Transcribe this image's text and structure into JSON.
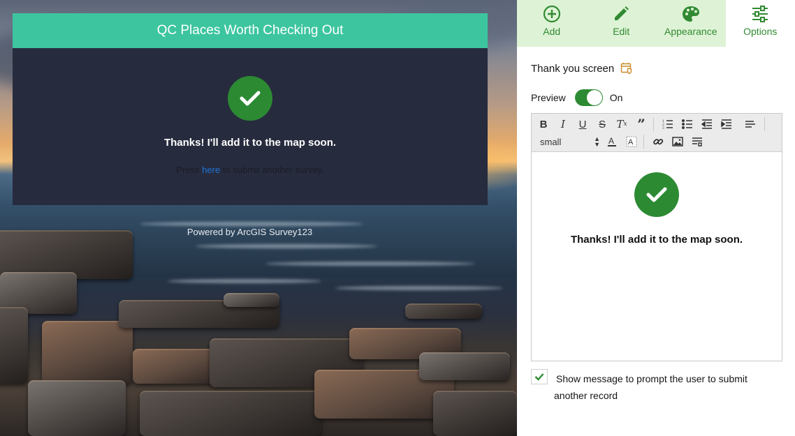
{
  "survey": {
    "title": "QC Places Worth Checking Out",
    "thanks_message": "Thanks! I'll add it to the map soon.",
    "press_prefix": "Press",
    "press_link": "here",
    "press_suffix": "to submit another survey.",
    "powered_by": "Powered by ArcGIS Survey123"
  },
  "toolbar": {
    "items": [
      {
        "label": "Add",
        "icon": "plus-circle-icon"
      },
      {
        "label": "Edit",
        "icon": "pencil-icon"
      },
      {
        "label": "Appearance",
        "icon": "palette-icon"
      },
      {
        "label": "Options",
        "icon": "sliders-icon",
        "active": true
      }
    ]
  },
  "panel": {
    "section_title": "Thank you screen",
    "preview_label": "Preview",
    "preview_state": "On",
    "editor": {
      "font_size": "small",
      "thanks_message": "Thanks! I'll add it to the map soon."
    },
    "option_label": "Show message to prompt the user to submit another record"
  },
  "colors": {
    "header_teal": "#3cc59f",
    "card_dark": "#272b3e",
    "success_green": "#2c8a33",
    "toolbar_tint": "#def3d6",
    "link_blue": "#1e74d8"
  }
}
